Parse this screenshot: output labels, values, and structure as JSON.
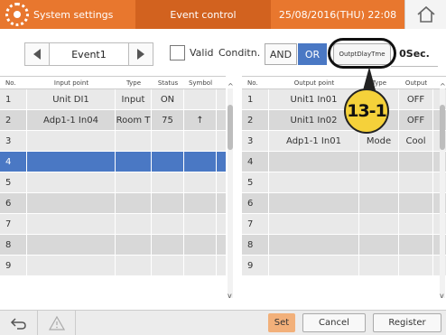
{
  "header": {
    "title": "System settings",
    "section": "Event control",
    "datetime": "25/08/2016(THU) 22:08",
    "home_icon": "home-icon"
  },
  "toolbar": {
    "event_name": "Event1",
    "valid_label": "Valid",
    "valid_checked": false,
    "condition_label": "Conditn.",
    "and_label": "AND",
    "or_label": "OR",
    "or_selected": true,
    "delay_button_label": "OutptDlayTme",
    "delay_value": "0Sec."
  },
  "annotation": {
    "label": "13-1"
  },
  "input_table": {
    "headers": [
      "No.",
      "Input point",
      "Type",
      "Status",
      "Symbol"
    ],
    "rows": [
      [
        "1",
        "Unit DI1",
        "Input",
        "ON",
        ""
      ],
      [
        "2",
        "Adp1-1 In04",
        "Room T",
        "75",
        "↑"
      ],
      [
        "3",
        "",
        "",
        "",
        ""
      ],
      [
        "4",
        "",
        "",
        "",
        ""
      ],
      [
        "5",
        "",
        "",
        "",
        ""
      ],
      [
        "6",
        "",
        "",
        "",
        ""
      ],
      [
        "7",
        "",
        "",
        "",
        ""
      ],
      [
        "8",
        "",
        "",
        "",
        ""
      ],
      [
        "9",
        "",
        "",
        "",
        ""
      ]
    ],
    "selected_row": 3
  },
  "output_table": {
    "headers": [
      "No.",
      "Output point",
      "Type",
      "Output"
    ],
    "rows": [
      [
        "1",
        "Unit1 In01",
        "",
        "OFF"
      ],
      [
        "2",
        "Unit1 In02",
        "N",
        "OFF"
      ],
      [
        "3",
        "Adp1-1 In01",
        "Mode",
        "Cool"
      ],
      [
        "4",
        "",
        "",
        ""
      ],
      [
        "5",
        "",
        "",
        ""
      ],
      [
        "6",
        "",
        "",
        ""
      ],
      [
        "7",
        "",
        "",
        ""
      ],
      [
        "8",
        "",
        "",
        ""
      ],
      [
        "9",
        "",
        "",
        ""
      ]
    ]
  },
  "footer": {
    "set_label": "Set",
    "cancel_label": "Cancel",
    "register_label": "Register"
  },
  "colors": {
    "header_orange": "#e8772e",
    "selected_blue": "#4a78c4",
    "set_button": "#f2b07a",
    "badge_yellow": "#f5d13a"
  }
}
